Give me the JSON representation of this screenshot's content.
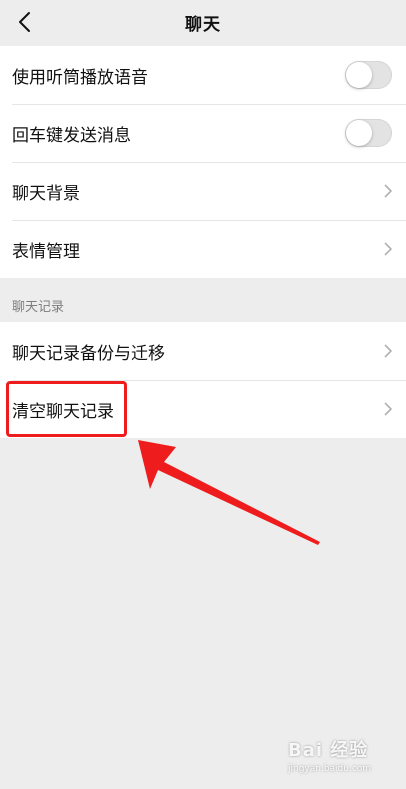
{
  "header": {
    "title": "聊天"
  },
  "settings": [
    {
      "label": "使用听筒播放语音",
      "control": "toggle",
      "on": false
    },
    {
      "label": "回车键发送消息",
      "control": "toggle",
      "on": false
    },
    {
      "label": "聊天背景",
      "control": "chevron"
    },
    {
      "label": "表情管理",
      "control": "chevron"
    }
  ],
  "chat_history": {
    "section_label": "聊天记录",
    "items": [
      {
        "label": "聊天记录备份与迁移"
      },
      {
        "label": "清空聊天记录"
      }
    ]
  },
  "annotation": {
    "color": "#ee1c1c"
  },
  "watermark": {
    "brand": "Bai 经验",
    "url": "jingyan.baidu.com"
  },
  "icons": {
    "back": "chevron-left-icon",
    "chevron": "chevron-right-icon"
  }
}
